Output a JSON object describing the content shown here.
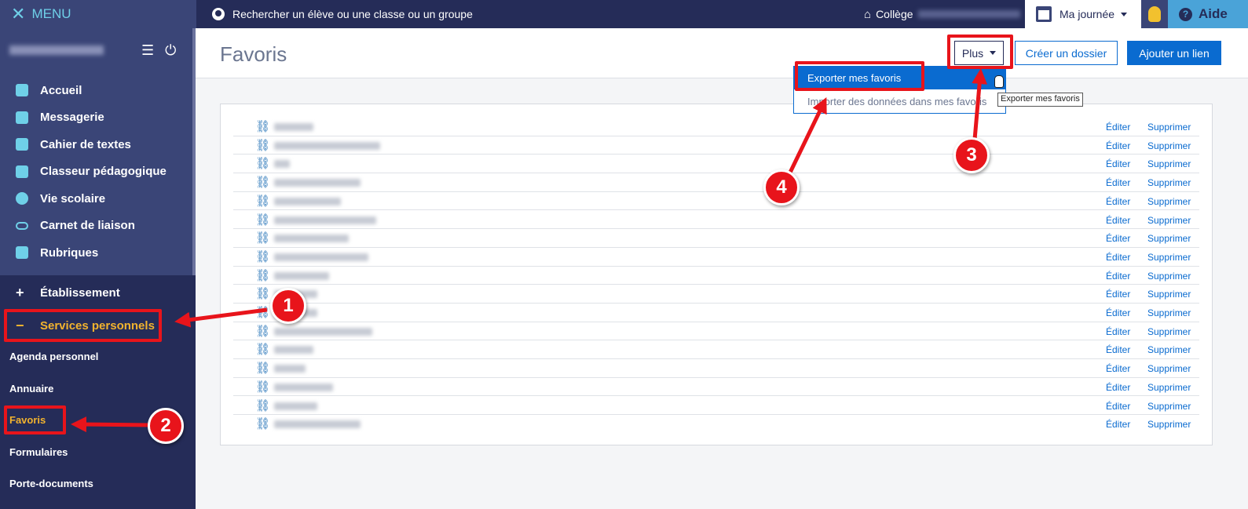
{
  "topbar": {
    "menu_label": "MENU",
    "search_label": "Rechercher un élève ou une classe ou un groupe",
    "college_label": "Collège",
    "journee_label": "Ma journée",
    "aide_label": "Aide"
  },
  "sidebar": {
    "items": [
      {
        "label": "Accueil",
        "name": "home"
      },
      {
        "label": "Messagerie",
        "name": "messagerie"
      },
      {
        "label": "Cahier de textes",
        "name": "cahier-de-textes"
      },
      {
        "label": "Classeur pédagogique",
        "name": "classeur-pedagogique"
      },
      {
        "label": "Vie scolaire",
        "name": "vie-scolaire"
      },
      {
        "label": "Carnet de liaison",
        "name": "carnet-de-liaison"
      },
      {
        "label": "Rubriques",
        "name": "rubriques"
      }
    ],
    "etablissement": "Établissement",
    "services": "Services personnels",
    "sub_items": [
      "Agenda personnel",
      "Annuaire",
      "Favoris",
      "Formulaires",
      "Porte-documents"
    ]
  },
  "main": {
    "title": "Favoris",
    "btn_plus": "Plus",
    "btn_folder": "Créer un dossier",
    "btn_add": "Ajouter un lien",
    "dropdown": {
      "export": "Exporter mes favoris",
      "import": "Importer des données dans mes favoris"
    },
    "tooltip": "Exporter mes favoris",
    "row_edit": "Éditer",
    "row_delete": "Supprimer"
  },
  "annotations": [
    "1",
    "2",
    "3",
    "4"
  ],
  "colors": {
    "accent": "#0a6bd0",
    "navy": "#252c58",
    "highlight": "#e8141b",
    "active_item": "#f2b32e"
  }
}
